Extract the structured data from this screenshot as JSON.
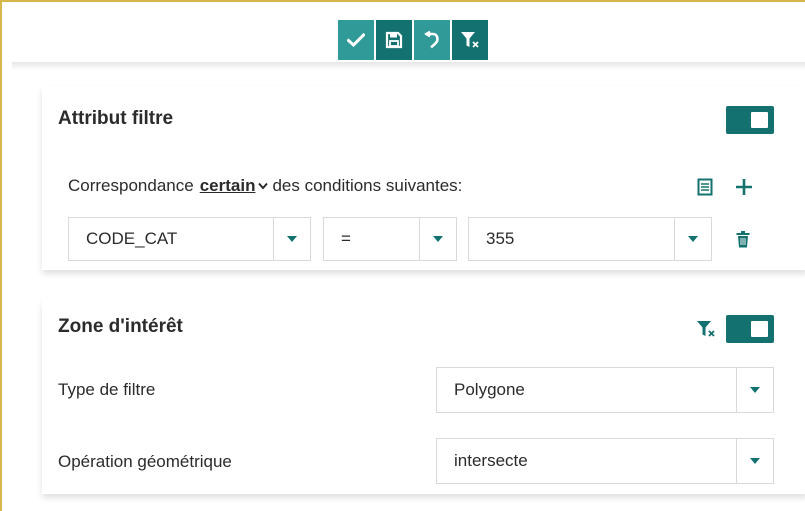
{
  "toolbar": {
    "buttons": [
      {
        "name": "apply",
        "icon": "check-icon"
      },
      {
        "name": "save",
        "icon": "save-icon"
      },
      {
        "name": "undo",
        "icon": "undo-icon"
      },
      {
        "name": "clear-filter",
        "icon": "filter-clear-icon"
      }
    ]
  },
  "attribute_filter": {
    "title": "Attribut filtre",
    "enabled": true,
    "match_prefix": "Correspondance",
    "match_mode": "certain",
    "match_suffix": "des conditions suivantes:",
    "condition": {
      "field": "CODE_CAT",
      "operator": "=",
      "value": "355"
    }
  },
  "zone": {
    "title": "Zone d'intérêt",
    "enabled": true,
    "filter_type_label": "Type de filtre",
    "filter_type_value": "Polygone",
    "geo_op_label": "Opération géométrique",
    "geo_op_value": "intersecte"
  },
  "colors": {
    "accent": "#137270",
    "accent_light": "#2f9a98",
    "frame": "#d6b84a"
  }
}
